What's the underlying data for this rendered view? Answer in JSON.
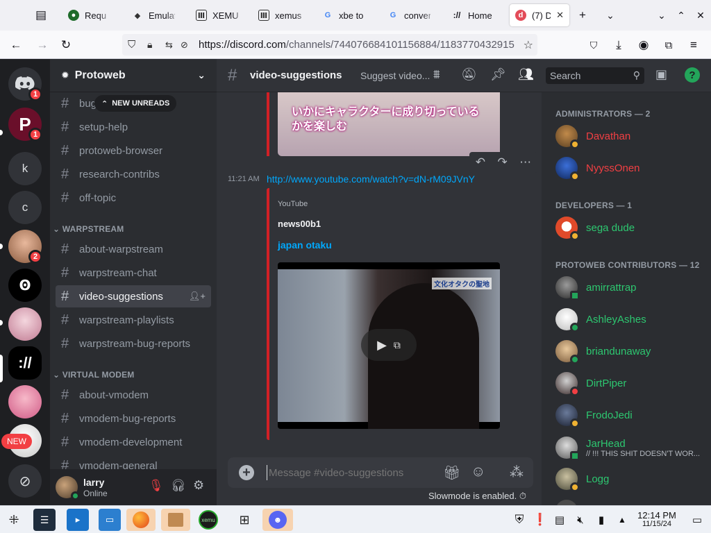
{
  "browser": {
    "tabs": [
      {
        "label": "Requir",
        "icon": "circle-icon"
      },
      {
        "label": "Emulat",
        "icon": "bookmark-icon"
      },
      {
        "label": "XEMU",
        "icon": "xemu-icon"
      },
      {
        "label": "xemus",
        "icon": "xemu-icon"
      },
      {
        "label": "xbe to",
        "icon": "google-icon"
      },
      {
        "label": "conver",
        "icon": "google-icon"
      },
      {
        "label": "Home",
        "icon": "slash-icon"
      },
      {
        "label": "(7) D",
        "icon": "discord-icon"
      }
    ],
    "url_host": "https://discord.com",
    "url_path": "/channels/744076684101156884/1183770432915"
  },
  "rail": {
    "servers": [
      {
        "name": "discord-home",
        "badge": "1"
      },
      {
        "name": "protoweb",
        "badge": "1"
      },
      {
        "name": "k",
        "letter": "k"
      },
      {
        "name": "c",
        "letter": "c"
      },
      {
        "name": "server-avatar-1",
        "badge": "2"
      },
      {
        "name": "server-avatar-2"
      },
      {
        "name": "server-avatar-3"
      },
      {
        "name": "server-avatar-4"
      },
      {
        "name": "server-avatar-5"
      },
      {
        "name": "server-avatar-6",
        "new_label": "NEW"
      }
    ]
  },
  "sidebar": {
    "server_name": "Protoweb",
    "new_unreads": "NEW UNREADS",
    "channels_top": [
      {
        "name": "bug-reports-feedba..."
      },
      {
        "name": "setup-help"
      },
      {
        "name": "protoweb-browser"
      },
      {
        "name": "research-contribs"
      },
      {
        "name": "off-topic"
      }
    ],
    "cat_warpstream": "WARPSTREAM",
    "channels_warp": [
      {
        "name": "about-warpstream"
      },
      {
        "name": "warpstream-chat"
      },
      {
        "name": "video-suggestions"
      },
      {
        "name": "warpstream-playlists"
      },
      {
        "name": "warpstream-bug-reports"
      }
    ],
    "cat_vmodem": "VIRTUAL MODEM",
    "channels_vmodem": [
      {
        "name": "about-vmodem"
      },
      {
        "name": "vmodem-bug-reports"
      },
      {
        "name": "vmodem-development"
      },
      {
        "name": "vmodem-general"
      }
    ]
  },
  "user": {
    "name": "larry",
    "status": "Online"
  },
  "header": {
    "channel": "video-suggestions",
    "topic": "Suggest video...",
    "search_placeholder": "Search"
  },
  "message": {
    "time": "11:21 AM",
    "link": "http://www.youtube.com/watch?v=dN-rM09JVnY",
    "provider": "YouTube",
    "author": "news00b1",
    "title": "japan otaku",
    "thumb_caption": "いかにキャラクターに成り切っているかを楽しむ",
    "video_caption": "文化オタクの聖地"
  },
  "composer": {
    "placeholder": "Message #video-suggestions",
    "slowmode": "Slowmode is enabled."
  },
  "members": {
    "groups": [
      {
        "label": "ADMINISTRATORS — 2",
        "color": "#f23f43",
        "members": [
          {
            "name": "Davathan",
            "sub": ""
          },
          {
            "name": "NyyssOnen",
            "sub": ""
          }
        ]
      },
      {
        "label": "DEVELOPERS — 1",
        "color": "#2dc770",
        "members": [
          {
            "name": "sega dude",
            "sub": ""
          }
        ]
      },
      {
        "label": "PROTOWEB CONTRIBUTORS — 12",
        "color": "#2dc770",
        "members": [
          {
            "name": "amirrattrap",
            "sub": ""
          },
          {
            "name": "AshleyAshes",
            "sub": ""
          },
          {
            "name": "briandunaway",
            "sub": ""
          },
          {
            "name": "DirtPiper",
            "sub": ""
          },
          {
            "name": "FrodoJedi",
            "sub": ""
          },
          {
            "name": "JarHead",
            "sub": "// !!! THIS SHIT DOESN'T WOR..."
          },
          {
            "name": "Logg",
            "sub": ""
          }
        ]
      }
    ]
  },
  "taskbar": {
    "time": "12:14 PM",
    "date": "11/15/24"
  },
  "colors": {
    "blurple": "#5865f2",
    "link": "#00a8fc",
    "embed_bar": "#d12026",
    "admin": "#f23f43",
    "contributor": "#2dc770"
  }
}
